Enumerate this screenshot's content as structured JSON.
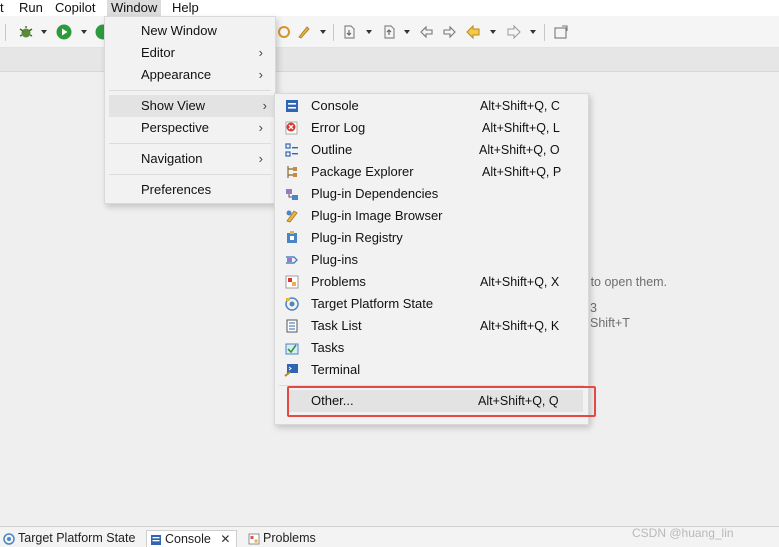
{
  "menubar": {
    "file_fragment": "t",
    "run": "Run",
    "copilot": "Copilot",
    "window": "Window",
    "help": "Help"
  },
  "window_menu": {
    "items": [
      {
        "label": "New Window"
      },
      {
        "label": "Editor"
      },
      {
        "label": "Appearance"
      },
      {
        "label": "Show View"
      },
      {
        "label": "Perspective"
      },
      {
        "label": "Navigation"
      },
      {
        "label": "Preferences"
      }
    ]
  },
  "show_view_menu": {
    "items": [
      {
        "label": "Console",
        "shortcut": "Alt+Shift+Q, C",
        "icon": "console-icon"
      },
      {
        "label": "Error Log",
        "shortcut": "Alt+Shift+Q, L",
        "icon": "error-log-icon"
      },
      {
        "label": "Outline",
        "shortcut": "Alt+Shift+Q, O",
        "icon": "outline-icon"
      },
      {
        "label": "Package Explorer",
        "shortcut": "Alt+Shift+Q, P",
        "icon": "package-explorer-icon"
      },
      {
        "label": "Plug-in Dependencies",
        "shortcut": "",
        "icon": "plugin-dependencies-icon"
      },
      {
        "label": "Plug-in Image Browser",
        "shortcut": "",
        "icon": "plugin-image-browser-icon"
      },
      {
        "label": "Plug-in Registry",
        "shortcut": "",
        "icon": "plugin-registry-icon"
      },
      {
        "label": "Plug-ins",
        "shortcut": "",
        "icon": "plugins-icon"
      },
      {
        "label": "Problems",
        "shortcut": "Alt+Shift+Q, X",
        "icon": "problems-icon"
      },
      {
        "label": "Target Platform State",
        "shortcut": "",
        "icon": "target-platform-icon"
      },
      {
        "label": "Task List",
        "shortcut": "Alt+Shift+Q, K",
        "icon": "task-list-icon"
      },
      {
        "label": "Tasks",
        "shortcut": "",
        "icon": "tasks-icon"
      },
      {
        "label": "Terminal",
        "shortcut": "",
        "icon": "terminal-icon"
      },
      {
        "label": "Other...",
        "shortcut": "Alt+Shift+Q, Q",
        "icon": ""
      }
    ]
  },
  "editor_hint": {
    "line1": "re to open them.",
    "line2": "3",
    "line3": "Shift+T"
  },
  "bottom_tabs": [
    {
      "label": "Target Platform State"
    },
    {
      "label": "Console"
    },
    {
      "label": "Problems"
    }
  ],
  "watermark": "CSDN @huang_lin",
  "colors": {
    "highlight_border": "#e34a46",
    "menu_bg": "#f2f2f2",
    "menu_hover": "#e3e3e3"
  }
}
